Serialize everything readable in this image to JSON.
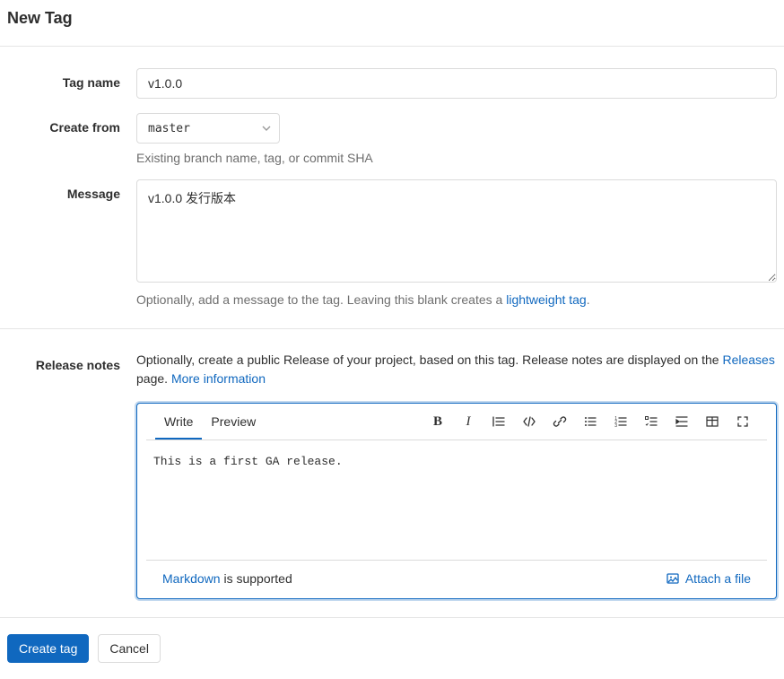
{
  "header": {
    "title": "New Tag"
  },
  "form": {
    "tag_name": {
      "label": "Tag name",
      "value": "v1.0.0"
    },
    "create_from": {
      "label": "Create from",
      "selected": "master",
      "hint": "Existing branch name, tag, or commit SHA"
    },
    "message": {
      "label": "Message",
      "value": "v1.0.0 发行版本",
      "hint_prefix": "Optionally, add a message to the tag. Leaving this blank creates a ",
      "hint_link": "lightweight tag",
      "hint_suffix": "."
    },
    "release_notes": {
      "label": "Release notes",
      "desc_prefix": "Optionally, create a public Release of your project, based on this tag. Release notes are displayed on the ",
      "desc_link1": "Releases",
      "desc_mid": " page. ",
      "desc_link2": "More information"
    }
  },
  "editor": {
    "tabs": {
      "write": "Write",
      "preview": "Preview"
    },
    "content": "This is a first GA release.",
    "footer": {
      "markdown_link": "Markdown",
      "markdown_rest": " is supported",
      "attach": "Attach a file"
    }
  },
  "actions": {
    "create": "Create tag",
    "cancel": "Cancel"
  }
}
